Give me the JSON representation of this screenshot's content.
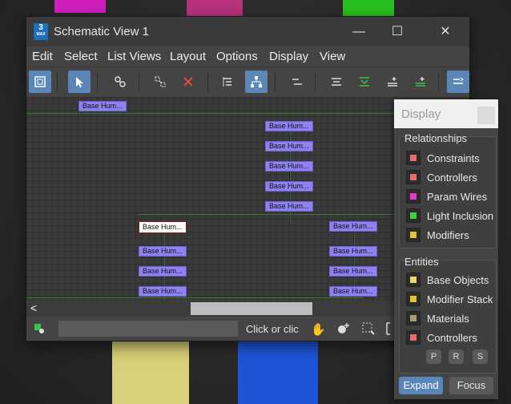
{
  "window": {
    "title": "Schematic View 1",
    "icon_text": "3",
    "icon_sub": "MAX",
    "minimize": "—",
    "maximize": "☐",
    "close": "✕"
  },
  "menu": [
    "Edit",
    "Select",
    "List Views",
    "Layout",
    "Options",
    "Display",
    "View"
  ],
  "toolbar": [
    {
      "name": "display-floater",
      "active": true
    },
    {
      "name": "select",
      "active": true
    },
    {
      "name": "connect",
      "active": false
    },
    {
      "name": "unlink-selected",
      "active": false
    },
    {
      "name": "delete-objects",
      "active": false
    },
    {
      "name": "hierarchy-mode",
      "active": false
    },
    {
      "name": "references-mode",
      "active": true
    },
    {
      "name": "move-children",
      "active": false
    },
    {
      "name": "expand-selected",
      "active": false
    },
    {
      "name": "collapse-selected",
      "active": false
    },
    {
      "name": "select-children",
      "active": false
    },
    {
      "name": "select-parent",
      "active": false
    },
    {
      "name": "preferences",
      "active": true
    }
  ],
  "nodes": {
    "label": "Base Hum...",
    "selected_label": "Base Hum..."
  },
  "scrollbar": {
    "left_arrow": "<"
  },
  "status": {
    "text": "Click or clic"
  },
  "display_panel": {
    "title": "Display",
    "relationships": {
      "label": "Relationships",
      "items": [
        {
          "label": "Constraints",
          "color": "#e76b6b"
        },
        {
          "label": "Controllers",
          "color": "#e76b6b"
        },
        {
          "label": "Param Wires",
          "color": "#e03cc8"
        },
        {
          "label": "Light Inclusion",
          "color": "#3fd43f"
        },
        {
          "label": "Modifiers",
          "color": "#e0c23a"
        }
      ]
    },
    "entities": {
      "label": "Entities",
      "items": [
        {
          "label": "Base Objects",
          "color": "#e8d870"
        },
        {
          "label": "Modifier Stack",
          "color": "#e0c23a"
        },
        {
          "label": "Materials",
          "color": "#a89a72"
        },
        {
          "label": "Controllers",
          "color": "#e76b6b"
        }
      ]
    },
    "filter_buttons": [
      "P",
      "R",
      "S"
    ],
    "expand_label": "Expand",
    "focus_label": "Focus"
  }
}
